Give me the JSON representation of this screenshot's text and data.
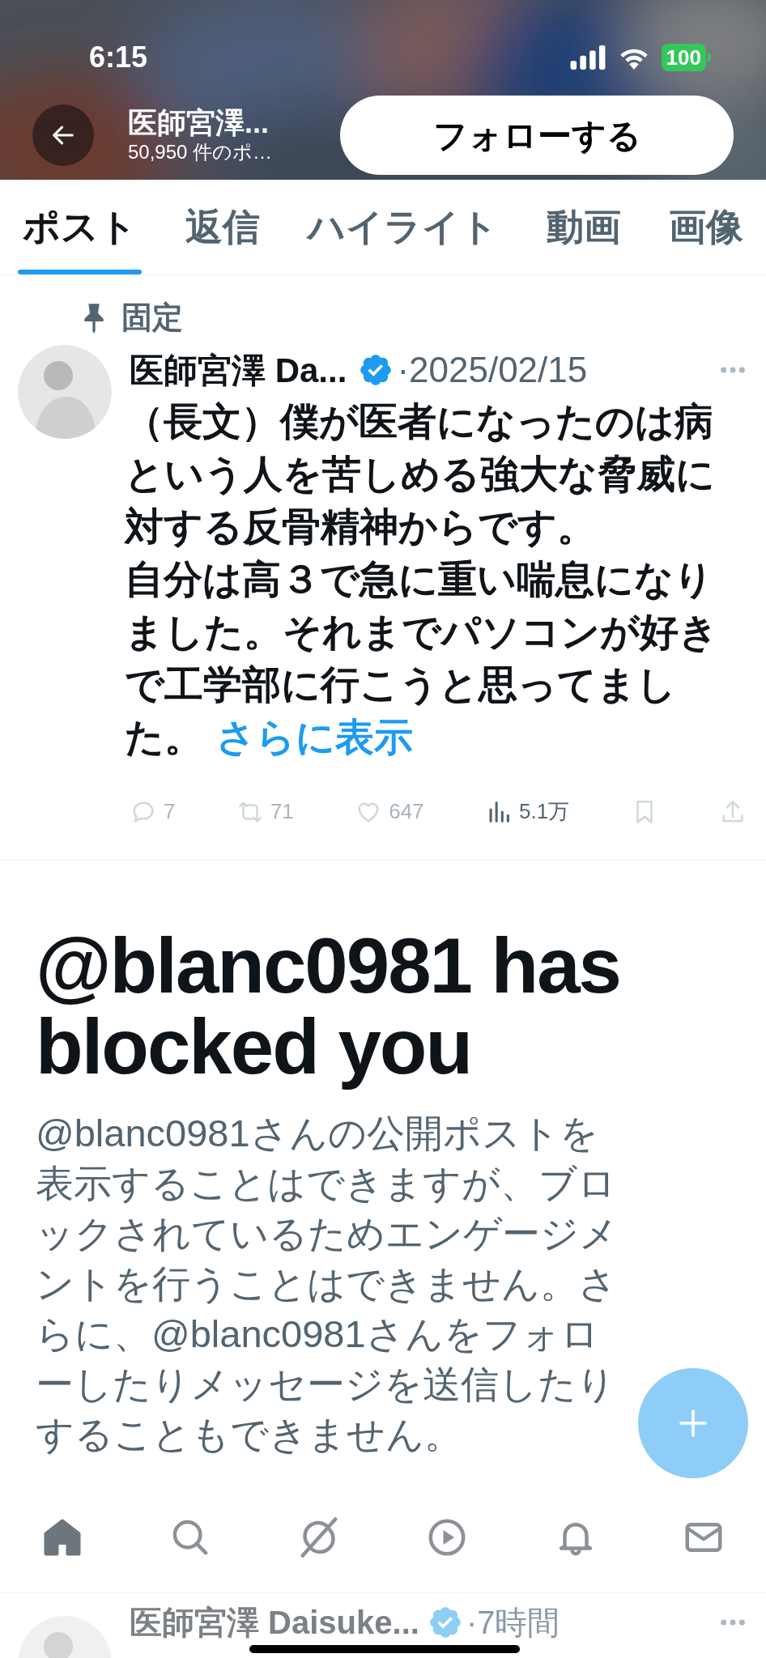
{
  "status_bar": {
    "time": "6:15",
    "battery": "100"
  },
  "header": {
    "name": "医師宮澤...",
    "post_count": "50,950 件のポ…",
    "follow_button": "フォローする"
  },
  "tabs": [
    {
      "label": "ポスト",
      "selected": true
    },
    {
      "label": "返信",
      "selected": false
    },
    {
      "label": "ハイライト",
      "selected": false
    },
    {
      "label": "動画",
      "selected": false
    },
    {
      "label": "画像",
      "selected": false
    }
  ],
  "pinned_post": {
    "pinned_label": "固定",
    "author": "医師宮澤 Da...",
    "verified": true,
    "date": "·2025/02/15",
    "body": [
      "（長文）僕が医者になったのは病という人を苦しめる強大な脅威に対する反骨精神からです。",
      "自分は高３で急に重い喘息になりました。それまでパソコンが好きで工学部に行こうと思ってました。"
    ],
    "show_more": "さらに表示",
    "actions": [
      {
        "kind": "reply",
        "count": "7",
        "disabled": true
      },
      {
        "kind": "repost",
        "count": "71",
        "disabled": true
      },
      {
        "kind": "like",
        "count": "647",
        "disabled": true
      },
      {
        "kind": "views",
        "count": "5.1万",
        "disabled": false
      },
      {
        "kind": "bookmark",
        "disabled": true
      },
      {
        "kind": "share",
        "disabled": true
      }
    ]
  },
  "block_notice": {
    "title": "@blanc0981 has blocked you",
    "message": "@blanc0981さんの公開ポストを表示することはできますが、ブロックされているためエンゲージメントを行うことはできません。さらに、@blanc0981さんをフォローしたりメッセージを送信したりすることもできません。"
  },
  "bottom_nav": [
    {
      "kind": "home",
      "selected": true
    },
    {
      "kind": "search",
      "selected": false
    },
    {
      "kind": "grok",
      "selected": false
    },
    {
      "kind": "video",
      "selected": false
    },
    {
      "kind": "notifications",
      "selected": false
    },
    {
      "kind": "messages",
      "selected": false
    }
  ],
  "next_post": {
    "author": "医師宮澤 Daisuke...",
    "verified": true,
    "time": "·7時間"
  }
}
